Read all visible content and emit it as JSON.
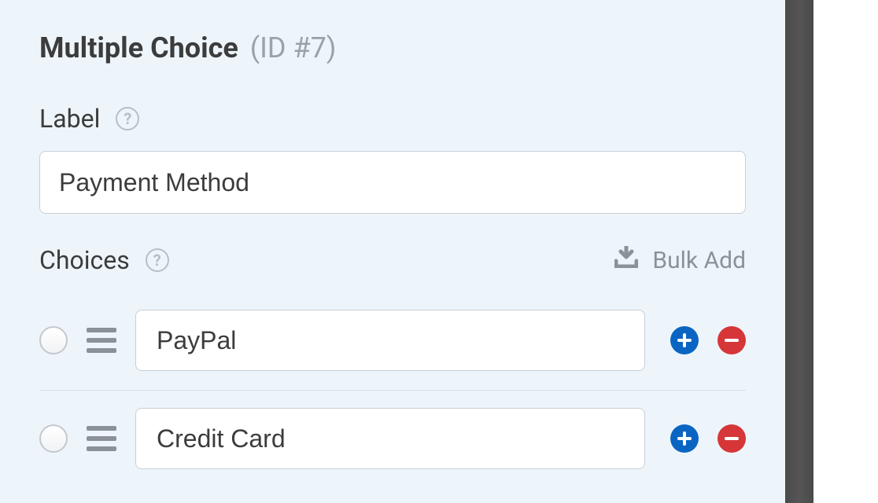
{
  "header": {
    "title": "Multiple Choice",
    "idLabel": "(ID #7)"
  },
  "labelField": {
    "label": "Label",
    "value": "Payment Method"
  },
  "choicesField": {
    "label": "Choices",
    "bulkAddLabel": "Bulk Add",
    "items": [
      {
        "value": "PayPal"
      },
      {
        "value": "Credit Card"
      }
    ]
  }
}
